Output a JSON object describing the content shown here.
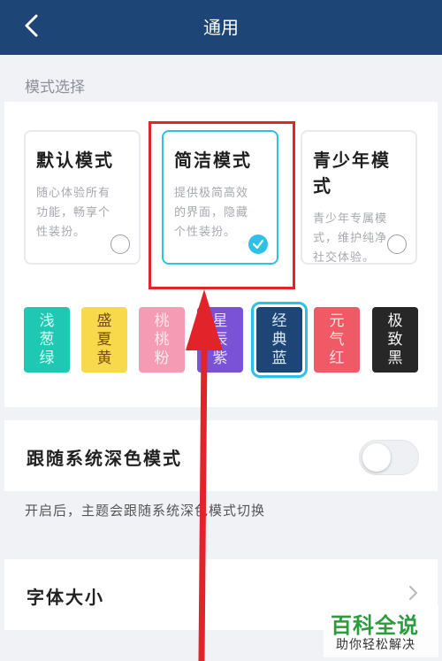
{
  "header": {
    "title": "通用",
    "back_icon": "chevron-left-icon",
    "color": "#1d4576"
  },
  "section_label": "模式选择",
  "modes": [
    {
      "title": "默认模式",
      "desc": [
        "随心体验所有",
        "功能，畅享个",
        "性装扮。"
      ],
      "selected": false
    },
    {
      "title": "简洁模式",
      "desc": [
        "提供极简高效",
        "的界面，隐藏",
        "个性装扮。"
      ],
      "selected": true
    },
    {
      "title": "青少年模式",
      "desc": [
        "青少年专属模",
        "式，维护纯净",
        "社交体验。"
      ],
      "selected": false
    }
  ],
  "themes": [
    {
      "label": "浅葱绿",
      "bg": "#1ec8b2",
      "fg": "#d9fff6"
    },
    {
      "label": "盛夏黄",
      "bg": "#f8d94c",
      "fg": "#7a4a12"
    },
    {
      "label": "桃桃粉",
      "bg": "#f69bb4",
      "fg": "#ffe9ef"
    },
    {
      "label": "星辰紫",
      "bg": "#7a52d6",
      "fg": "#e7dcff"
    },
    {
      "label": "经典蓝",
      "bg": "#1d4576",
      "fg": "#dbe8f7",
      "selected": true
    },
    {
      "label": "元气红",
      "bg": "#f05a66",
      "fg": "#ffe2e4"
    },
    {
      "label": "极致黑",
      "bg": "#272727",
      "fg": "#f4f4f4"
    }
  ],
  "follow_system": {
    "label": "跟随系统深色模式",
    "enabled": false,
    "hint": "开启后，主题会跟随系统深色模式切换"
  },
  "font_size": {
    "label": "字体大小"
  },
  "watermark": {
    "title": "百科全说",
    "subtitle": "助你轻松解决"
  },
  "accent": "#2ec0e6",
  "annotation_color": "#e1232a"
}
